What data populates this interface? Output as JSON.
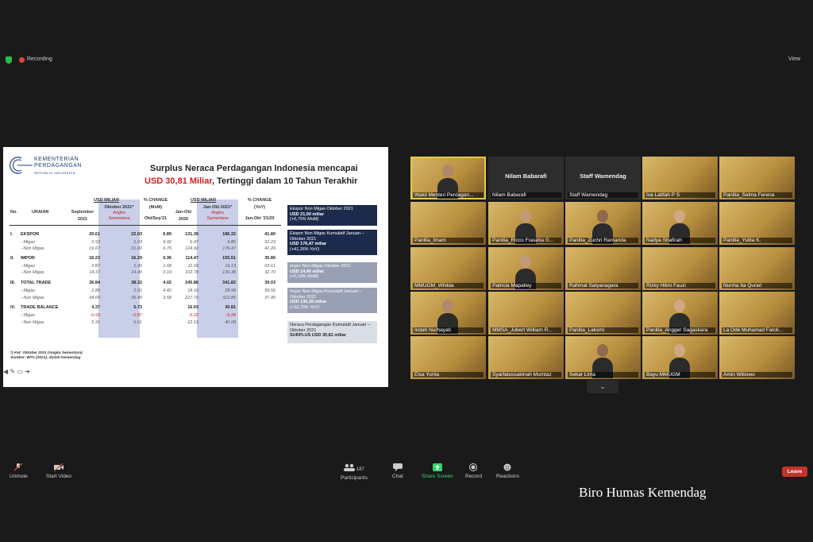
{
  "topbar": {
    "recording": "Recording",
    "view": "View"
  },
  "slide": {
    "org1": "KEMENTERIAN",
    "org2": "PERDAGANGAN",
    "org3": "REPUBLIK INDONESIA",
    "title1": "Surplus Neraca Perdagangan Indonesia mencapai",
    "title2_red": "USD 30,81 Miliar",
    "title2_rest": ", Tertinggi dalam 10 Tahun Terakhir",
    "hdr": {
      "no": "No.",
      "uraian": "URAIAN",
      "usd1": "USD MILIAR",
      "sep": "September",
      "sep_y": "2021",
      "okt": "Oktober 2021*",
      "angka": "Angka",
      "sementara": "Sementara",
      "chg1a": "% CHANGE",
      "chg1b": "(MoM)",
      "chg1c": "Okt/Sep'21",
      "usd2": "USD MILIAR",
      "jo20": "Jan-Okt",
      "jo20y": "2020",
      "jo21": "Jan-Okt 2021*",
      "chg2a": "% CHANGE",
      "chg2b": "(YoY)",
      "chg2c": "Jan-Okt '21/20"
    },
    "rows": [
      {
        "no": "I.",
        "label": "EKSPOR",
        "c1": "20.61",
        "c2": "22.03",
        "c3": "6.89",
        "c4": "131.39",
        "c5": "186.32",
        "c6": "41.80"
      },
      {
        "label": "- Migas",
        "c1": "0.93",
        "c2": "1.03",
        "c3": "9.92",
        "c4": "6.47",
        "c5": "9.85",
        "c6": "52.23"
      },
      {
        "label": "- Non Migas",
        "c1": "19.67",
        "c2": "21.00",
        "c3": "6.75",
        "c4": "124.92",
        "c5": "176.47",
        "c6": "41.26"
      },
      {
        "no": "II.",
        "label": "IMPOR",
        "c1": "16.23",
        "c2": "16.29",
        "c3": "0.36",
        "c4": "114.47",
        "c5": "155.51",
        "c6": "35.86"
      },
      {
        "label": "- Migas",
        "c1": "1.87",
        "c2": "1.90",
        "c3": "1.68",
        "c4": "11.69",
        "c5": "19.13",
        "c6": "63.61"
      },
      {
        "label": "- Non Migas",
        "c1": "14.37",
        "c2": "14.40",
        "c3": "0.19",
        "c4": "102.78",
        "c5": "136.38",
        "c6": "32.70"
      },
      {
        "no": "III.",
        "label": "TOTAL TRADE",
        "c1": "36.84",
        "c2": "38.32",
        "c3": "4.02",
        "c4": "245.86",
        "c5": "341.82",
        "c6": "39.03"
      },
      {
        "label": "- Migas",
        "c1": "2.80",
        "c2": "2.92",
        "c3": "4.42",
        "c4": "18.16",
        "c5": "28.98",
        "c6": "59.56"
      },
      {
        "label": "- Non Migas",
        "c1": "34.04",
        "c2": "35.40",
        "c3": "3.58",
        "c4": "227.70",
        "c5": "312.85",
        "c6": "37.40"
      },
      {
        "no": "IV.",
        "label": "TRADE BALANCE",
        "c1": "4.37",
        "c2": "5.73",
        "c3": "",
        "c4": "16.93",
        "c5": "30.81",
        "c6": ""
      },
      {
        "label": "- Migas",
        "c1": "-0.93",
        "c2": "-0.87",
        "c3": "",
        "c4": "-5.22",
        "c5": "-9.28",
        "c6": ""
      },
      {
        "label": "- Non Migas",
        "c1": "5.31",
        "c2": "6.61",
        "c3": "",
        "c4": "22.15",
        "c5": "40.08",
        "c6": ""
      }
    ],
    "boxes": [
      {
        "t": "Ekspor Non Migas Oktober 2021",
        "v": "USD 21,00 miliar",
        "p": "(+6,75% MoM)"
      },
      {
        "t": "Ekspor Non Migas Kumulatif Januari – Oktober 2021",
        "v": "USD 176,47 miliar",
        "p": "(+41,26% YoY)"
      },
      {
        "t": "Impor Non Migas Oktober 2021",
        "v": "USD 14,40 miliar",
        "p": "(+0,19% MoM)"
      },
      {
        "t": "Impor Non Migas Kumulatif Januari – Oktober 2021",
        "v": "USD 136,38 miliar",
        "p": "(+32,70% YoY)"
      },
      {
        "t": "Neraca Perdagangan Kumulatif Januari – Oktober 2021",
        "v": "SURPLUS USD 30,81 miliar",
        "p": ""
      }
    ],
    "note1": "*) Ket: Oktober 2021 (Angka Sementara)",
    "note2": "Sumber: BPS (2021), diolah Kemendag"
  },
  "gallery": [
    "Wakil Menteri Perdagan...",
    "Nilam Babarafi",
    "Staff Wamendag",
    "Iva Latifah P S",
    "Panitia_Selma Ferena",
    "Panitia_Imam",
    "Panitia_Ricco Frasetia G...",
    "Panitia_Zuchri Ramanda",
    "Nadya Shafirah",
    "Panitia_Yulita K.",
    "MMUGM_Whilda",
    "Patricia Mapaliey",
    "Rahmat Satyanagara",
    "Rizky Hilmi Fauzi",
    "Nurma Ita Qurari",
    "Indah Nurhayati",
    "MMSA_Jubert William R...",
    "Panitia_Laksmi",
    "Panitia_Angger Sagaskara",
    "La Ode Muhamad Fatoli...",
    "Elsa Yurita",
    "Syarfatussakinah Mumtaz",
    "Sekar Lima",
    "Bayu MMUGM",
    "Amin Wibowo"
  ],
  "gallery_center": {
    "nilam": "Nilam Babarafi",
    "staff": "Staff Wamendag"
  },
  "controls": {
    "unmute": "Unmute",
    "video": "Start Video",
    "participants": "Participants",
    "count": "187",
    "chat": "Chat",
    "share": "Share Screen",
    "record": "Record",
    "reactions": "Reactions",
    "leave": "Leave"
  },
  "watermark": "Biro Humas Kemendag",
  "colors": {
    "accent_red": "#d02020",
    "share_green": "#3bd16f",
    "leave_red": "#c4332c"
  }
}
